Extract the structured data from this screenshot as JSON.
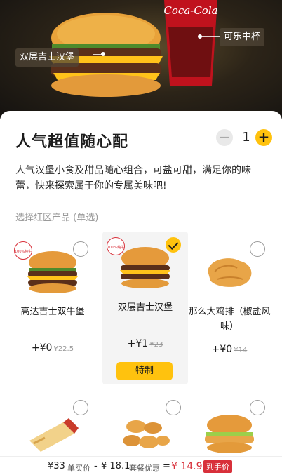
{
  "hero": {
    "burger_tag": "双层吉士汉堡",
    "cola_tag": "可乐中杯",
    "cup_brand": "Coca-Cola"
  },
  "header": {
    "title": "人气超值随心配",
    "quantity": "1",
    "minus_label": "−",
    "plus_label": "+"
  },
  "description": "人气汉堡小食及甜品随心组合，可盐可甜，满足你的味蕾，快来探索属于你的专属美味吧!",
  "section_label": "选择红区产品 (单选)",
  "products": [
    {
      "name": "高达吉士双牛堡",
      "price": "+¥0",
      "original": "¥22.5",
      "badge": "100%纯牛肉",
      "selected": false
    },
    {
      "name": "双层吉士汉堡",
      "price": "+¥1",
      "original": "¥23",
      "badge": "100%纯牛肉",
      "selected": true,
      "button": "特制"
    },
    {
      "name": "那么大鸡排（椒盐风味）",
      "price": "+¥0",
      "original": "¥14",
      "selected": false
    },
    {
      "name": "",
      "selected": false
    },
    {
      "name": "",
      "selected": false
    },
    {
      "name": "",
      "selected": false
    }
  ],
  "footer": {
    "unit_total": "¥33",
    "unit_label": "单买价",
    "minus": "-",
    "discount": "¥ 18.1",
    "discount_label": "套餐优惠",
    "equals": "=",
    "final": "¥ 14.9",
    "final_tag": "到手价"
  },
  "colors": {
    "accent": "#ffc20e",
    "red": "#d8303a",
    "muted": "#9a9a9a"
  }
}
